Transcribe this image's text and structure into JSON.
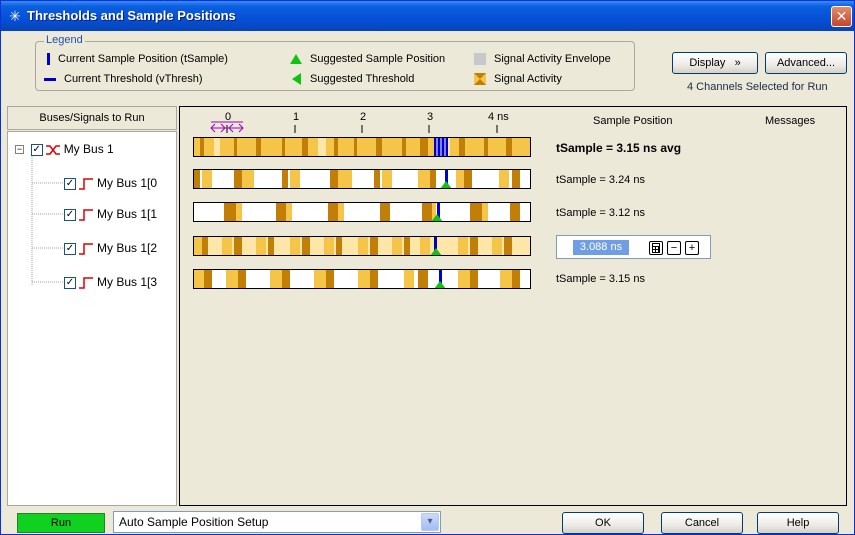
{
  "window": {
    "title": "Thresholds and Sample Positions",
    "close": "✕"
  },
  "legend": {
    "caption": "Legend",
    "items": [
      "Current Sample Position (tSample)",
      "Current Threshold (vThresh)",
      "Suggested Sample Position",
      "Suggested Threshold",
      "Signal Activity Envelope",
      "Signal Activity"
    ]
  },
  "toolbar": {
    "display": "Display",
    "advanced": "Advanced...",
    "channels_info": "4 Channels Selected for Run"
  },
  "tree": {
    "header": "Buses/Signals to Run",
    "expander": "−",
    "check": "✓",
    "items": [
      {
        "label": "My Bus 1",
        "checked": true
      },
      {
        "label": "My Bus 1[0",
        "checked": true
      },
      {
        "label": "My Bus 1[1",
        "checked": true
      },
      {
        "label": "My Bus 1[2",
        "checked": true
      },
      {
        "label": "My Bus 1[3",
        "checked": true
      }
    ]
  },
  "scale": {
    "labels": [
      "0",
      "1",
      "2",
      "3",
      "4 ns"
    ]
  },
  "columns": {
    "sample_position": "Sample Position",
    "messages": "Messages"
  },
  "rows": [
    {
      "tsample": "tSample =  3.15 ns avg"
    },
    {
      "tsample": "tSample =  3.24 ns"
    },
    {
      "tsample": "tSample =  3.12 ns"
    },
    {
      "tsample": ""
    },
    {
      "tsample": "tSample =  3.15 ns"
    }
  ],
  "editor": {
    "value": "3.088 ns",
    "minus": "−",
    "plus": "+"
  },
  "footer": {
    "run": "Run",
    "mode": "Auto Sample Position Setup",
    "mode_arrow": "▾",
    "ok": "OK",
    "cancel": "Cancel",
    "help": "Help"
  },
  "colors": {
    "envelope": "#f5c54a",
    "activity": "#c27f08",
    "light": "#fde6a8",
    "sample": "#0000cc",
    "suggest": "#11c311"
  }
}
